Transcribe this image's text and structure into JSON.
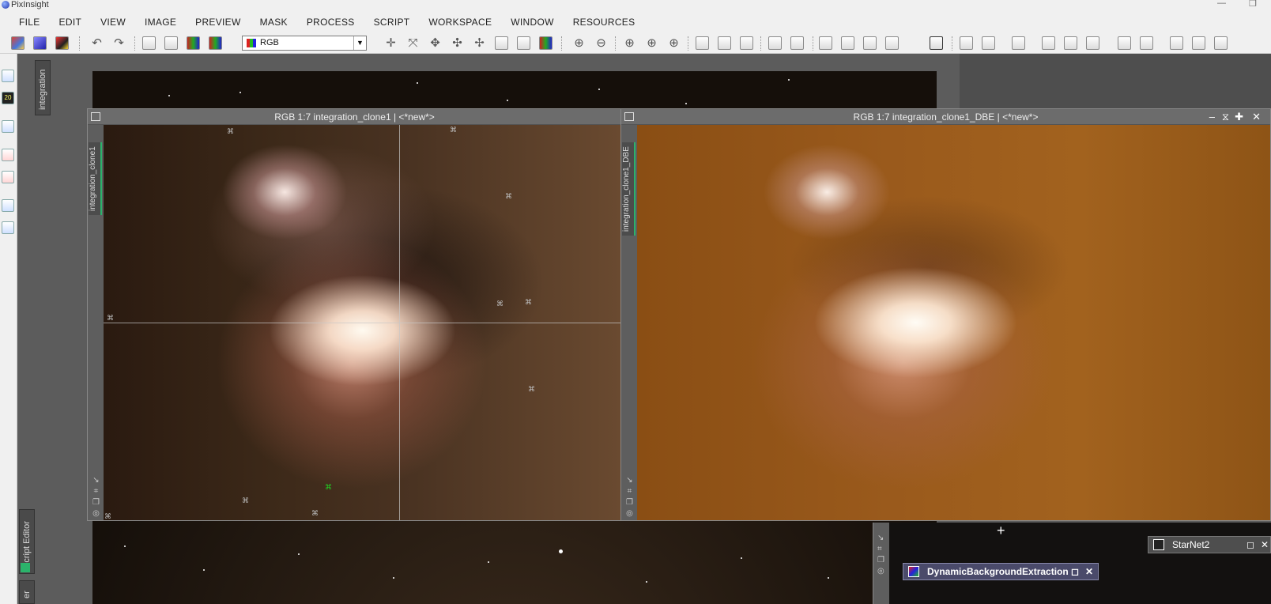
{
  "app": {
    "title": "PixInsight"
  },
  "menu": [
    "FILE",
    "EDIT",
    "VIEW",
    "IMAGE",
    "PREVIEW",
    "MASK",
    "PROCESS",
    "SCRIPT",
    "WORKSPACE",
    "WINDOW",
    "RESOURCES"
  ],
  "toolbar": {
    "view_select_value": "RGB"
  },
  "side_tabs": {
    "integration": "integration",
    "script_editor": "Script Editor",
    "bottom_partial": "er"
  },
  "windows": {
    "left": {
      "title": "RGB 1:7 integration_clone1 | <*new*>",
      "id": "integration_clone1"
    },
    "right": {
      "title": "RGB 1:7 integration_clone1_DBE | <*new*>",
      "id": "integration_clone1_DBE"
    }
  },
  "process_icons": {
    "dbe": "DynamicBackgroundExtraction",
    "starnet": "StarNet2"
  },
  "colors": {
    "accent_green": "#2bb36b",
    "process_icon_bg": "#4a4a6a",
    "dbe_tint": "#9a5a1c"
  }
}
